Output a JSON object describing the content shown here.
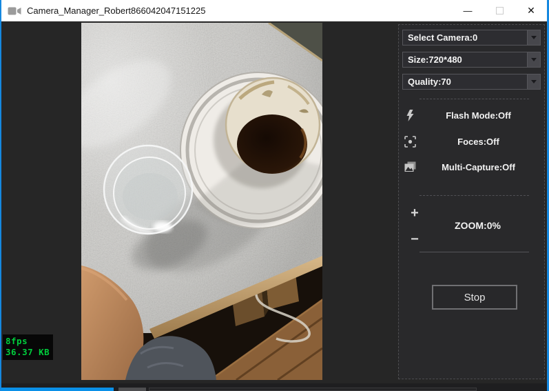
{
  "window": {
    "title": "Camera_Manager_Robert866042047151225",
    "minimize_glyph": "—",
    "close_glyph": "✕"
  },
  "preview": {
    "stats_fps": "8fps",
    "stats_size": "36.37 KB"
  },
  "panel": {
    "dropdowns": [
      {
        "label": "Select Camera:0"
      },
      {
        "label": "Size:720*480"
      },
      {
        "label": "Quality:70"
      }
    ],
    "options": [
      {
        "icon": "flash-icon",
        "label": "Flash Mode:Off"
      },
      {
        "icon": "focus-icon",
        "label": "Foces:Off"
      },
      {
        "icon": "multi-capture-icon",
        "label": "Multi-Capture:Off"
      }
    ],
    "zoom": {
      "plus_glyph": "+",
      "minus_glyph": "−",
      "label": "ZOOM:0%"
    },
    "stop_label": "Stop"
  },
  "colors": {
    "accent_border": "#1588e0",
    "stats_green": "#00cd3c",
    "titlebar_bg": "#ffffff",
    "client_bg": "#262626"
  }
}
